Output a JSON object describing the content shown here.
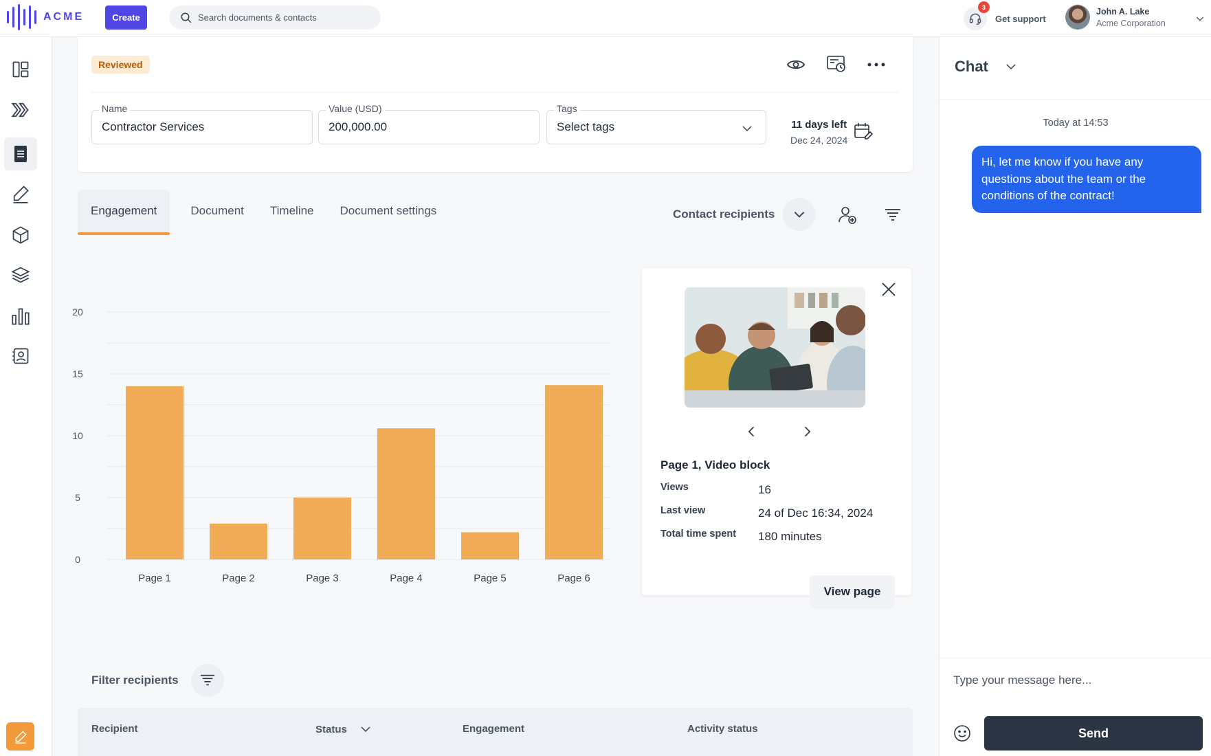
{
  "app": {
    "logo_text": "ACME",
    "create_label": "Create",
    "search_placeholder": "Search documents & contacts",
    "support": {
      "label": "Get support",
      "badge": "3"
    },
    "user": {
      "name": "John A. Lake",
      "org": "Acme Corporation"
    }
  },
  "document": {
    "status": "Reviewed",
    "fields": {
      "name": {
        "label": "Name",
        "value": "Contractor Services"
      },
      "value": {
        "label": "Value (USD)",
        "value": "200,000.00"
      },
      "tags": {
        "label": "Tags",
        "value": "Select tags"
      }
    },
    "deadline": {
      "days_left": "11 days left",
      "date": "Dec 24, 2024"
    }
  },
  "tabs": [
    {
      "label": "Engagement",
      "active": true
    },
    {
      "label": "Document",
      "active": false
    },
    {
      "label": "Timeline",
      "active": false
    },
    {
      "label": "Document settings",
      "active": false
    }
  ],
  "contact_recipients_label": "Contact recipients",
  "chart_data": {
    "type": "bar",
    "categories": [
      "Page 1",
      "Page 2",
      "Page 3",
      "Page 4",
      "Page 5",
      "Page 6"
    ],
    "values": [
      14,
      2.9,
      5,
      10.6,
      2.2,
      14.1
    ],
    "ylim": [
      0,
      20
    ],
    "yticks": [
      0,
      5,
      10,
      15,
      20
    ],
    "grid": true,
    "bar_color": "#f2ac58"
  },
  "info": {
    "title": "Page 1, Video block",
    "rows": [
      {
        "key": "Views",
        "value": "16"
      },
      {
        "key": "Last view",
        "value": "24 of Dec 16:34, 2024"
      },
      {
        "key": "Total time spent",
        "value": "180 minutes"
      }
    ],
    "view_page_label": "View page"
  },
  "filter_label": "Filter recipients",
  "table": {
    "columns": [
      "Recipient",
      "Status",
      "Engagement",
      "Activity status"
    ]
  },
  "chat": {
    "title": "Chat",
    "timestamp": "Today at 14:53",
    "message": "Hi, let me know if you have any questions about the team or the conditions of the contract!",
    "input_placeholder": "Type your message here...",
    "send_label": "Send"
  },
  "colors": {
    "brand": "#4f46e5",
    "accent": "#f39b3a",
    "bubble": "#2463eb",
    "send": "#2b3442"
  }
}
